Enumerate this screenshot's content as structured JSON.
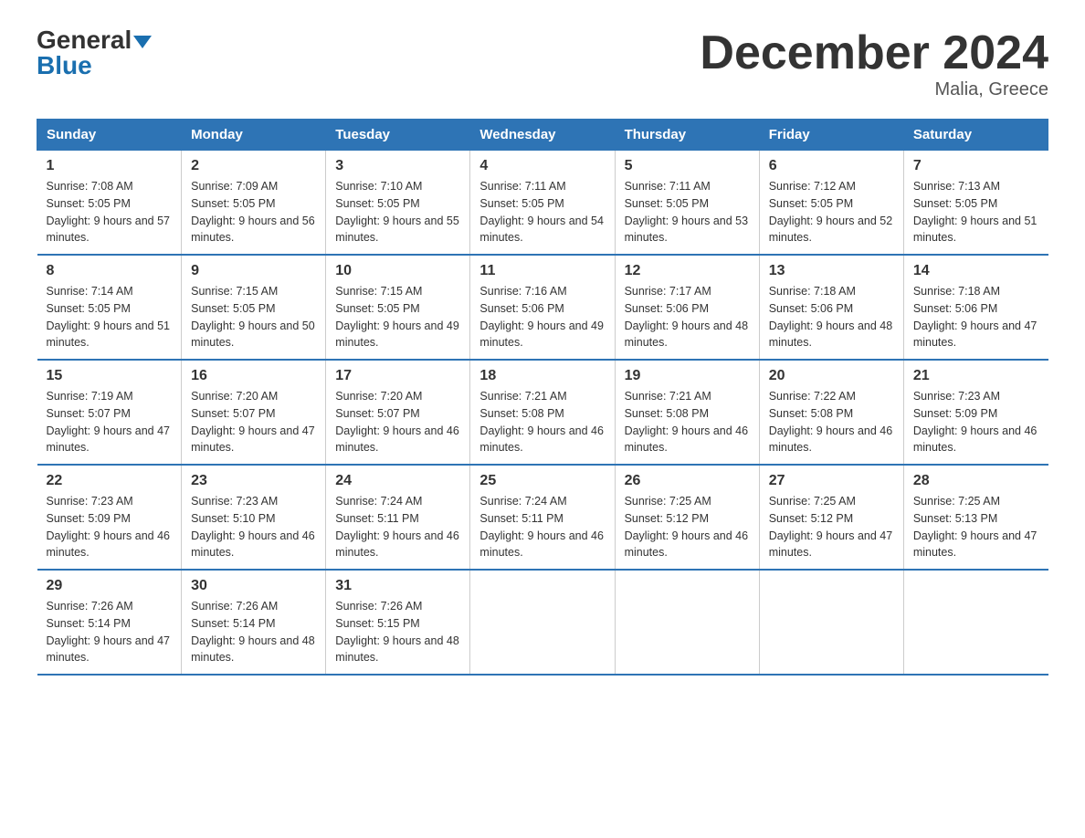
{
  "header": {
    "logo_general": "General",
    "logo_blue": "Blue",
    "month_title": "December 2024",
    "location": "Malia, Greece"
  },
  "days_of_week": [
    "Sunday",
    "Monday",
    "Tuesday",
    "Wednesday",
    "Thursday",
    "Friday",
    "Saturday"
  ],
  "weeks": [
    [
      {
        "day": "1",
        "sunrise": "Sunrise: 7:08 AM",
        "sunset": "Sunset: 5:05 PM",
        "daylight": "Daylight: 9 hours and 57 minutes."
      },
      {
        "day": "2",
        "sunrise": "Sunrise: 7:09 AM",
        "sunset": "Sunset: 5:05 PM",
        "daylight": "Daylight: 9 hours and 56 minutes."
      },
      {
        "day": "3",
        "sunrise": "Sunrise: 7:10 AM",
        "sunset": "Sunset: 5:05 PM",
        "daylight": "Daylight: 9 hours and 55 minutes."
      },
      {
        "day": "4",
        "sunrise": "Sunrise: 7:11 AM",
        "sunset": "Sunset: 5:05 PM",
        "daylight": "Daylight: 9 hours and 54 minutes."
      },
      {
        "day": "5",
        "sunrise": "Sunrise: 7:11 AM",
        "sunset": "Sunset: 5:05 PM",
        "daylight": "Daylight: 9 hours and 53 minutes."
      },
      {
        "day": "6",
        "sunrise": "Sunrise: 7:12 AM",
        "sunset": "Sunset: 5:05 PM",
        "daylight": "Daylight: 9 hours and 52 minutes."
      },
      {
        "day": "7",
        "sunrise": "Sunrise: 7:13 AM",
        "sunset": "Sunset: 5:05 PM",
        "daylight": "Daylight: 9 hours and 51 minutes."
      }
    ],
    [
      {
        "day": "8",
        "sunrise": "Sunrise: 7:14 AM",
        "sunset": "Sunset: 5:05 PM",
        "daylight": "Daylight: 9 hours and 51 minutes."
      },
      {
        "day": "9",
        "sunrise": "Sunrise: 7:15 AM",
        "sunset": "Sunset: 5:05 PM",
        "daylight": "Daylight: 9 hours and 50 minutes."
      },
      {
        "day": "10",
        "sunrise": "Sunrise: 7:15 AM",
        "sunset": "Sunset: 5:05 PM",
        "daylight": "Daylight: 9 hours and 49 minutes."
      },
      {
        "day": "11",
        "sunrise": "Sunrise: 7:16 AM",
        "sunset": "Sunset: 5:06 PM",
        "daylight": "Daylight: 9 hours and 49 minutes."
      },
      {
        "day": "12",
        "sunrise": "Sunrise: 7:17 AM",
        "sunset": "Sunset: 5:06 PM",
        "daylight": "Daylight: 9 hours and 48 minutes."
      },
      {
        "day": "13",
        "sunrise": "Sunrise: 7:18 AM",
        "sunset": "Sunset: 5:06 PM",
        "daylight": "Daylight: 9 hours and 48 minutes."
      },
      {
        "day": "14",
        "sunrise": "Sunrise: 7:18 AM",
        "sunset": "Sunset: 5:06 PM",
        "daylight": "Daylight: 9 hours and 47 minutes."
      }
    ],
    [
      {
        "day": "15",
        "sunrise": "Sunrise: 7:19 AM",
        "sunset": "Sunset: 5:07 PM",
        "daylight": "Daylight: 9 hours and 47 minutes."
      },
      {
        "day": "16",
        "sunrise": "Sunrise: 7:20 AM",
        "sunset": "Sunset: 5:07 PM",
        "daylight": "Daylight: 9 hours and 47 minutes."
      },
      {
        "day": "17",
        "sunrise": "Sunrise: 7:20 AM",
        "sunset": "Sunset: 5:07 PM",
        "daylight": "Daylight: 9 hours and 46 minutes."
      },
      {
        "day": "18",
        "sunrise": "Sunrise: 7:21 AM",
        "sunset": "Sunset: 5:08 PM",
        "daylight": "Daylight: 9 hours and 46 minutes."
      },
      {
        "day": "19",
        "sunrise": "Sunrise: 7:21 AM",
        "sunset": "Sunset: 5:08 PM",
        "daylight": "Daylight: 9 hours and 46 minutes."
      },
      {
        "day": "20",
        "sunrise": "Sunrise: 7:22 AM",
        "sunset": "Sunset: 5:08 PM",
        "daylight": "Daylight: 9 hours and 46 minutes."
      },
      {
        "day": "21",
        "sunrise": "Sunrise: 7:23 AM",
        "sunset": "Sunset: 5:09 PM",
        "daylight": "Daylight: 9 hours and 46 minutes."
      }
    ],
    [
      {
        "day": "22",
        "sunrise": "Sunrise: 7:23 AM",
        "sunset": "Sunset: 5:09 PM",
        "daylight": "Daylight: 9 hours and 46 minutes."
      },
      {
        "day": "23",
        "sunrise": "Sunrise: 7:23 AM",
        "sunset": "Sunset: 5:10 PM",
        "daylight": "Daylight: 9 hours and 46 minutes."
      },
      {
        "day": "24",
        "sunrise": "Sunrise: 7:24 AM",
        "sunset": "Sunset: 5:11 PM",
        "daylight": "Daylight: 9 hours and 46 minutes."
      },
      {
        "day": "25",
        "sunrise": "Sunrise: 7:24 AM",
        "sunset": "Sunset: 5:11 PM",
        "daylight": "Daylight: 9 hours and 46 minutes."
      },
      {
        "day": "26",
        "sunrise": "Sunrise: 7:25 AM",
        "sunset": "Sunset: 5:12 PM",
        "daylight": "Daylight: 9 hours and 46 minutes."
      },
      {
        "day": "27",
        "sunrise": "Sunrise: 7:25 AM",
        "sunset": "Sunset: 5:12 PM",
        "daylight": "Daylight: 9 hours and 47 minutes."
      },
      {
        "day": "28",
        "sunrise": "Sunrise: 7:25 AM",
        "sunset": "Sunset: 5:13 PM",
        "daylight": "Daylight: 9 hours and 47 minutes."
      }
    ],
    [
      {
        "day": "29",
        "sunrise": "Sunrise: 7:26 AM",
        "sunset": "Sunset: 5:14 PM",
        "daylight": "Daylight: 9 hours and 47 minutes."
      },
      {
        "day": "30",
        "sunrise": "Sunrise: 7:26 AM",
        "sunset": "Sunset: 5:14 PM",
        "daylight": "Daylight: 9 hours and 48 minutes."
      },
      {
        "day": "31",
        "sunrise": "Sunrise: 7:26 AM",
        "sunset": "Sunset: 5:15 PM",
        "daylight": "Daylight: 9 hours and 48 minutes."
      },
      {
        "day": "",
        "sunrise": "",
        "sunset": "",
        "daylight": ""
      },
      {
        "day": "",
        "sunrise": "",
        "sunset": "",
        "daylight": ""
      },
      {
        "day": "",
        "sunrise": "",
        "sunset": "",
        "daylight": ""
      },
      {
        "day": "",
        "sunrise": "",
        "sunset": "",
        "daylight": ""
      }
    ]
  ]
}
